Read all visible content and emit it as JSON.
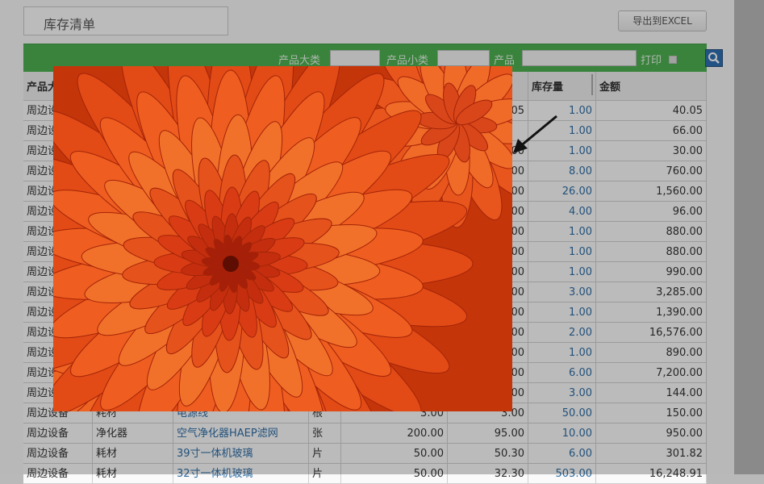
{
  "page": {
    "title": "库存清单",
    "export_label": "导出到EXCEL"
  },
  "filter": {
    "category_label": "产品大类",
    "category_value": "",
    "subcategory_label": "产品小类",
    "subcategory_value": "",
    "product_label": "产品",
    "product_value": "",
    "print_label": "打印"
  },
  "table": {
    "headers": {
      "category": "产品大类",
      "stock": "库存量",
      "amount": "金额"
    },
    "rows": [
      {
        "category": "周边设备",
        "subcategory": "",
        "product": "",
        "unit": "",
        "price": "",
        "cost": "05",
        "stock": "1.00",
        "amount": "40.05"
      },
      {
        "category": "周边设备",
        "subcategory": "",
        "product": "",
        "unit": "",
        "price": "",
        "cost": "",
        "stock": "1.00",
        "amount": "66.00"
      },
      {
        "category": "周边设备",
        "subcategory": "",
        "product": "",
        "unit": "",
        "price": "",
        "cost": "00",
        "stock": "1.00",
        "amount": "30.00"
      },
      {
        "category": "周边设备",
        "subcategory": "",
        "product": "",
        "unit": "",
        "price": "",
        "cost": "00",
        "stock": "8.00",
        "amount": "760.00"
      },
      {
        "category": "周边设备",
        "subcategory": "",
        "product": "",
        "unit": "",
        "price": "",
        "cost": "00",
        "stock": "26.00",
        "amount": "1,560.00"
      },
      {
        "category": "周边设备",
        "subcategory": "",
        "product": "",
        "unit": "",
        "price": "",
        "cost": "00",
        "stock": "4.00",
        "amount": "96.00"
      },
      {
        "category": "周边设备",
        "subcategory": "",
        "product": "",
        "unit": "",
        "price": "",
        "cost": "00",
        "stock": "1.00",
        "amount": "880.00"
      },
      {
        "category": "周边设备",
        "subcategory": "",
        "product": "",
        "unit": "",
        "price": "",
        "cost": "00",
        "stock": "1.00",
        "amount": "880.00"
      },
      {
        "category": "周边设备",
        "subcategory": "",
        "product": "",
        "unit": "",
        "price": "",
        "cost": "00",
        "stock": "1.00",
        "amount": "990.00"
      },
      {
        "category": "周边设备",
        "subcategory": "",
        "product": "",
        "unit": "",
        "price": "",
        "cost": "00",
        "stock": "3.00",
        "amount": "3,285.00"
      },
      {
        "category": "周边设备",
        "subcategory": "",
        "product": "",
        "unit": "",
        "price": "",
        "cost": "00",
        "stock": "1.00",
        "amount": "1,390.00"
      },
      {
        "category": "周边设备",
        "subcategory": "",
        "product": "",
        "unit": "",
        "price": "",
        "cost": "00",
        "stock": "2.00",
        "amount": "16,576.00"
      },
      {
        "category": "周边设备",
        "subcategory": "",
        "product": "",
        "unit": "",
        "price": "",
        "cost": "00",
        "stock": "1.00",
        "amount": "890.00"
      },
      {
        "category": "周边设备",
        "subcategory": "",
        "product": "",
        "unit": "",
        "price": "",
        "cost": "00",
        "stock": "6.00",
        "amount": "7,200.00"
      },
      {
        "category": "周边设备",
        "subcategory": "",
        "product": "",
        "unit": "",
        "price": "",
        "cost": "00",
        "stock": "3.00",
        "amount": "144.00"
      },
      {
        "category": "周边设备",
        "subcategory": "耗材",
        "product": "电源线",
        "unit": "根",
        "price": "3.00",
        "cost": "3.00",
        "stock": "50.00",
        "amount": "150.00"
      },
      {
        "category": "周边设备",
        "subcategory": "净化器",
        "product": "空气净化器HAEP滤网",
        "unit": "张",
        "price": "200.00",
        "cost": "95.00",
        "stock": "10.00",
        "amount": "950.00"
      },
      {
        "category": "周边设备",
        "subcategory": "耗材",
        "product": "39寸一体机玻璃",
        "unit": "片",
        "price": "50.00",
        "cost": "50.30",
        "stock": "6.00",
        "amount": "301.82"
      },
      {
        "category": "周边设备",
        "subcategory": "耗材",
        "product": "32寸一体机玻璃",
        "unit": "片",
        "price": "50.00",
        "cost": "32.30",
        "stock": "503.00",
        "amount": "16,248.91"
      }
    ]
  },
  "colors": {
    "filter_bar": "#4caf50",
    "link": "#2e6da4",
    "search_button": "#2f6fb0"
  },
  "icons": {
    "search": "search-icon",
    "arrow": "pointer-arrow-icon"
  }
}
